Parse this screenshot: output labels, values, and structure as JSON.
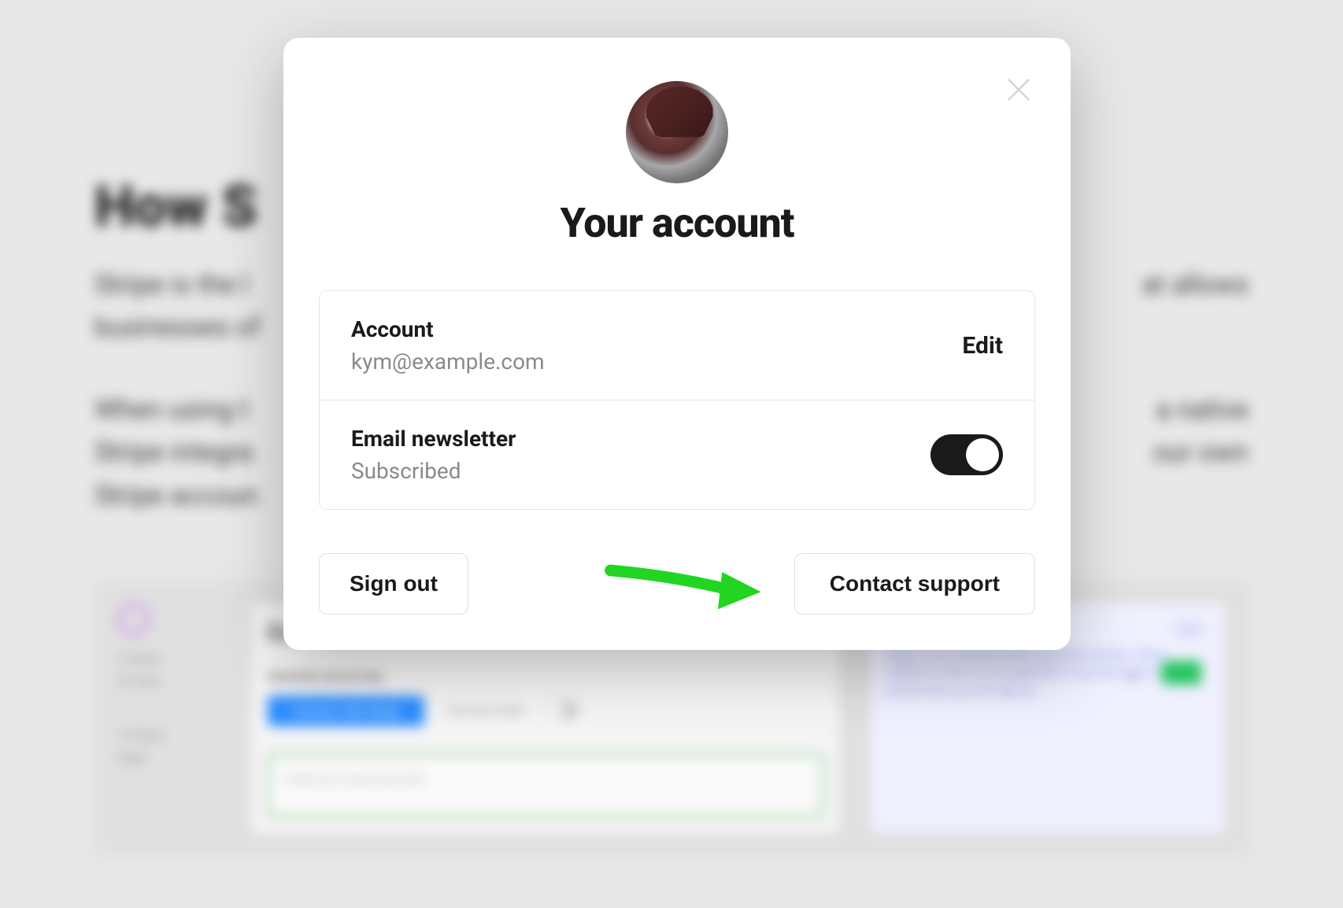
{
  "background": {
    "title": "How S",
    "paragraph1_left": "Stripe is the l",
    "paragraph1_right": "at allows",
    "paragraph1_line2": "businesses of",
    "paragraph2_left": "When using t",
    "paragraph2_mid_right": "a native",
    "paragraph2_line2_left": "Stripe integra",
    "paragraph2_line2_right": "our own",
    "paragraph2_line3": "Stripe accoun",
    "panel": {
      "sidebar_publ": "Publ",
      "connect_title": "Co",
      "generate_label": "Generate secure key",
      "connect_btn": "Connect with Stripe",
      "test_mode": "Use test mode",
      "placeholder": "Paste your secure key here",
      "info_title": "Getting paid",
      "info_badge": "stripe",
      "info_text": "Stripe is our exclusive direct payments partner. Ghost collects no fees on any payments! If you don't have a Stripe account yet, you can sign up"
    }
  },
  "modal": {
    "title": "Your account",
    "account": {
      "label": "Account",
      "value": "kym@example.com",
      "edit": "Edit"
    },
    "newsletter": {
      "label": "Email newsletter",
      "value": "Subscribed",
      "enabled": true
    },
    "buttons": {
      "signout": "Sign out",
      "contact": "Contact support"
    }
  }
}
